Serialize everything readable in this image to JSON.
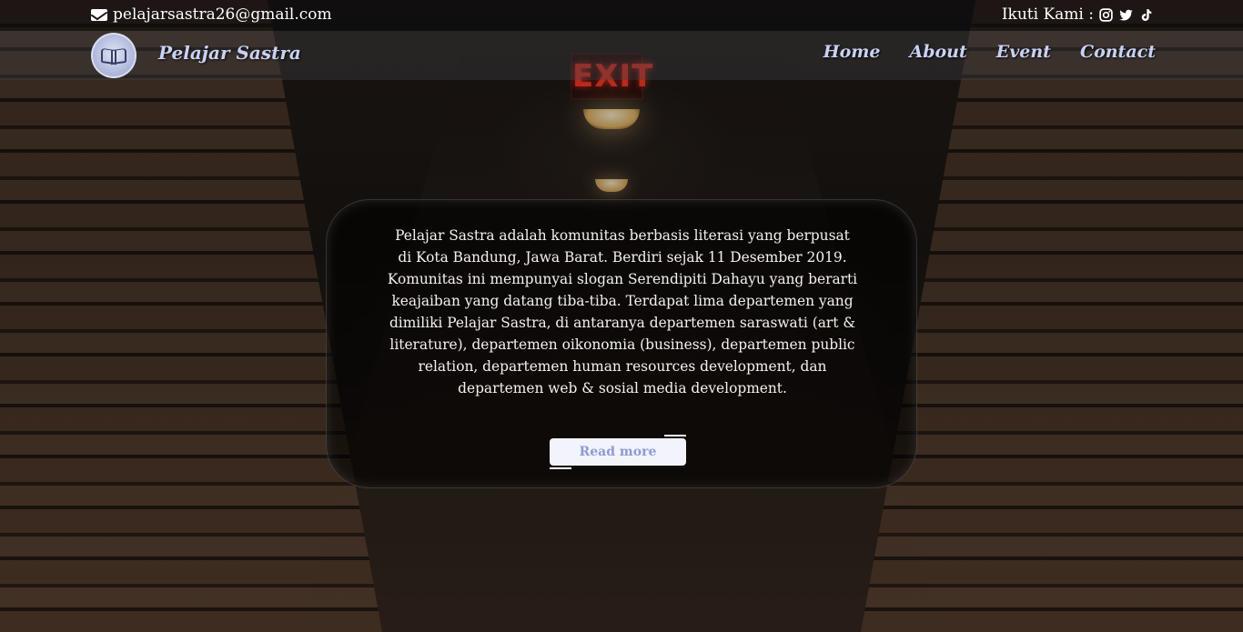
{
  "topbar": {
    "email": "pelajarsastra26@gmail.com",
    "follow_label": "Ikuti Kami :",
    "social_icons": [
      "instagram-icon",
      "twitter-icon",
      "tiktok-icon"
    ]
  },
  "navbar": {
    "brand": "Pelajar Sastra",
    "links": [
      {
        "label": "Home"
      },
      {
        "label": "About"
      },
      {
        "label": "Event"
      },
      {
        "label": "Contact"
      }
    ]
  },
  "hero": {
    "description": "Pelajar Sastra adalah komunitas berbasis literasi yang berpusat di Kota Bandung, Jawa Barat. Berdiri sejak 11 Desember 2019. Komunitas ini mempunyai slogan Serendipiti Dahayu yang berarti keajaiban yang datang tiba-tiba. Terdapat lima departemen yang dimiliki Pelajar Sastra, di antaranya departemen saraswati (art & literature), departemen oikonomia (business), departemen public relation, departemen human resources development, dan departemen web & sosial media development.",
    "button_label": "Read more"
  },
  "background": {
    "sign_text": "EXIT"
  },
  "colors": {
    "brand": "#c9d2f4",
    "button_text": "#8e9ad2",
    "button_bg": "#f2f3fb"
  }
}
